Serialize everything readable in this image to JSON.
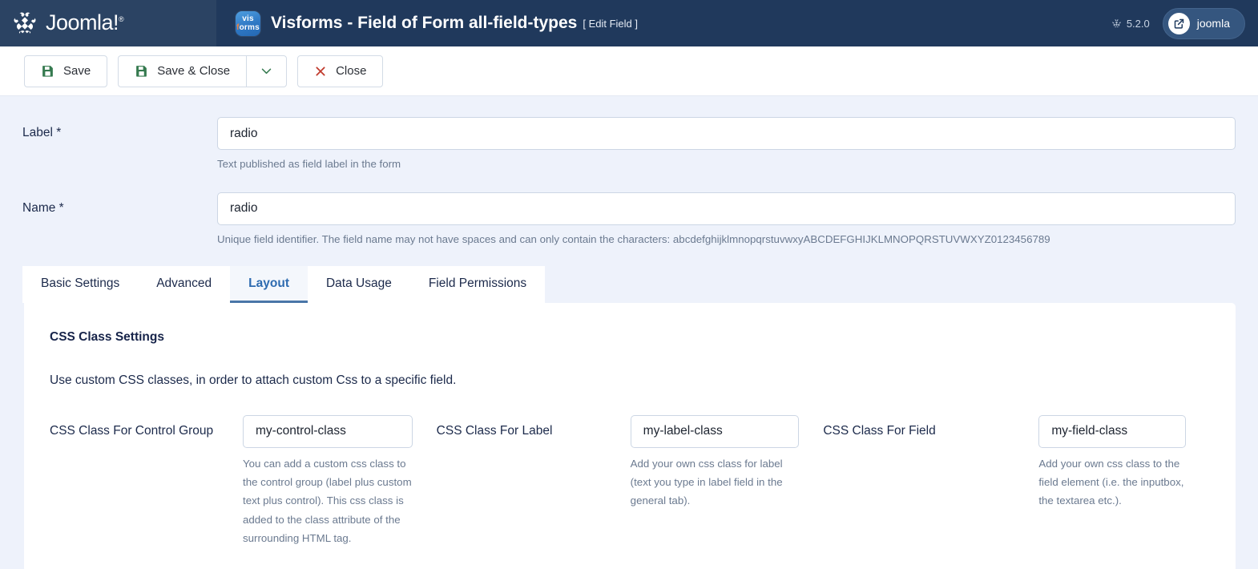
{
  "header": {
    "brand_name": "Joomla!",
    "brand_icon": "joomla-logo-icon",
    "app_icon": "visforms-logo-icon",
    "app_icon_line1": "vis",
    "app_icon_line2_accent": "f",
    "app_icon_line2_rest": "orms",
    "title": "Visforms - Field of Form all-field-types",
    "subtitle": "[ Edit Field ]",
    "version": "5.2.0",
    "version_icon": "joomla-mark-icon",
    "user_pill_label": "joomla",
    "user_pill_icon": "external-link-icon"
  },
  "toolbar": {
    "save_label": "Save",
    "save_icon": "floppy-disk-icon",
    "save_close_label": "Save & Close",
    "save_close_icon": "floppy-disk-icon",
    "caret_icon": "chevron-down-icon",
    "close_label": "Close",
    "close_icon": "x-icon",
    "accent_green": "#357a4f",
    "accent_red": "#c0392b"
  },
  "form": {
    "label_field": {
      "label": "Label *",
      "value": "radio",
      "placeholder": "",
      "help": "Text published as field label in the form"
    },
    "name_field": {
      "label": "Name *",
      "value": "radio",
      "placeholder": "",
      "help": "Unique field identifier. The field name may not have spaces and can only contain the characters: abcdefghijklmnopqrstuvwxyABCDEFGHIJKLMNOPQRSTUVWXYZ0123456789"
    }
  },
  "tabs": [
    {
      "label": "Basic Settings",
      "active": false
    },
    {
      "label": "Advanced",
      "active": false
    },
    {
      "label": "Layout",
      "active": true
    },
    {
      "label": "Data Usage",
      "active": false
    },
    {
      "label": "Field Permissions",
      "active": false
    }
  ],
  "panel": {
    "title": "CSS Class Settings",
    "description": "Use custom CSS classes, in order to attach custom Css to a specific field.",
    "columns": [
      {
        "label": "CSS Class For Control Group",
        "value": "my-control-class",
        "placeholder": "",
        "help": "You can add a custom css class to the control group (label plus custom text plus control). This css class is added to the class attribute of the surrounding HTML tag."
      },
      {
        "label": "CSS Class For Label",
        "value": "my-label-class",
        "placeholder": "",
        "help": "Add your own css class for label (text you type in label field in the general tab)."
      },
      {
        "label": "CSS Class For Field",
        "value": "my-field-class",
        "placeholder": "",
        "help": "Add your own css class to the field element (i.e. the inputbox, the textarea etc.)."
      }
    ]
  },
  "colors": {
    "header_bg": "#20395c",
    "header_brand_bg": "#2b4363",
    "page_bg": "#eef2fb",
    "active_tab_text": "#2e6bb0",
    "active_tab_underline": "#4a76a8"
  }
}
